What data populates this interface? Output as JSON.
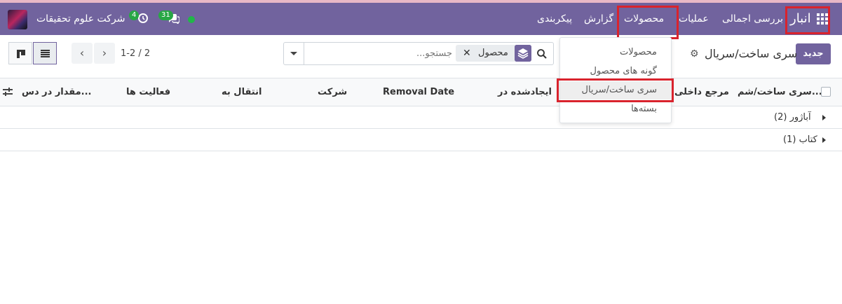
{
  "navbar": {
    "app_title": "انبار",
    "menu": [
      {
        "label": "بررسی اجمالی"
      },
      {
        "label": "عملیات"
      },
      {
        "label": "محصولات"
      },
      {
        "label": "گزارش"
      },
      {
        "label": "پیکربندی"
      }
    ],
    "messages_count": "31",
    "activities_count": "4",
    "company": "شرکت علوم تحقیقات",
    "colors": {
      "bar": "#71639e",
      "highlight": "#d9232d",
      "badge": "#28a745"
    }
  },
  "products_menu": {
    "items": [
      {
        "label": "محصولات"
      },
      {
        "label": "گونه های محصول"
      },
      {
        "label": "سری ساخت/سریال"
      },
      {
        "label": "بسته‌ها"
      }
    ]
  },
  "control_panel": {
    "new_label": "جدید",
    "title": "سری ساخت/سریال",
    "facet_label": "محصول",
    "search_placeholder": "جستجو...",
    "pager": "1-2 / 2"
  },
  "table": {
    "columns": [
      {
        "label": "سری ساخت/شم..."
      },
      {
        "label": "مرجع داخلی"
      },
      {
        "label": "ایجادشده در"
      },
      {
        "label": "Removal Date"
      },
      {
        "label": "شرکت"
      },
      {
        "label": "انتقال به"
      },
      {
        "label": "فعالیت ها"
      },
      {
        "label": "مقدار در دس..."
      }
    ],
    "groups": [
      {
        "label": "آباژور (2)"
      },
      {
        "label": "کتاب (1)"
      }
    ]
  },
  "icons": [
    "apps-grid-icon",
    "chat-icon",
    "clock-icon",
    "online-status-icon",
    "gear-icon",
    "search-icon",
    "layers-icon",
    "close-icon",
    "chevron-left-icon",
    "chevron-right-icon",
    "kanban-view-icon",
    "list-view-icon",
    "column-options-icon",
    "caret-right-icon"
  ]
}
